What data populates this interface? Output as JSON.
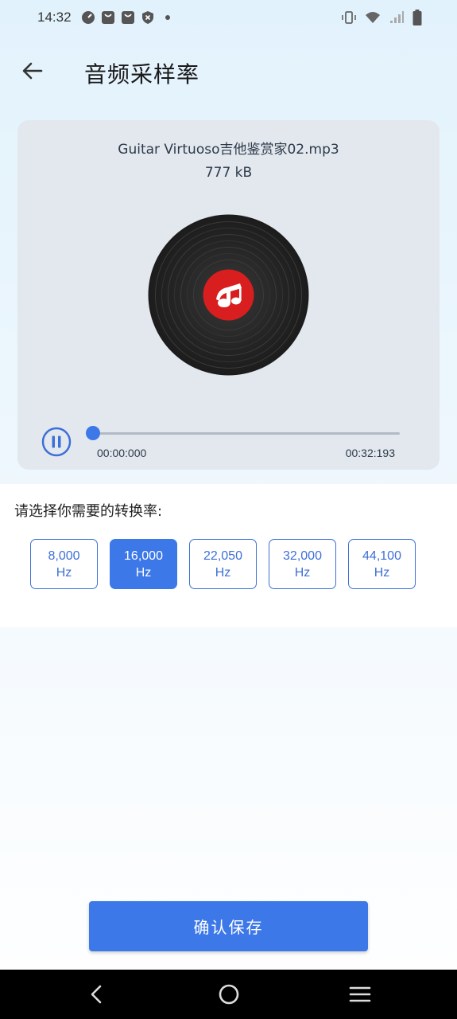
{
  "status_bar": {
    "time": "14:32",
    "left_icons": [
      "speedometer-icon",
      "shopping-bag-icon",
      "shopping-bag-icon",
      "shield-x-icon",
      "dot-icon"
    ],
    "right_icons": [
      "vibrate-icon",
      "wifi-icon",
      "signal-icon",
      "battery-icon"
    ]
  },
  "app_bar": {
    "back_icon": "arrow-left-icon",
    "title": "音频采样率"
  },
  "player": {
    "file_name": "Guitar Virtuoso吉他鉴赏家02.mp3",
    "file_size": "777 kB",
    "state_icon": "pause-icon",
    "current_time": "00:00:000",
    "total_time": "00:32:193",
    "progress": 0.0
  },
  "rate_panel": {
    "prompt": "请选择你需要的转换率:",
    "options": [
      {
        "value": "8,000",
        "unit": "Hz",
        "selected": false
      },
      {
        "value": "16,000",
        "unit": "Hz",
        "selected": true
      },
      {
        "value": "22,050",
        "unit": "Hz",
        "selected": false
      },
      {
        "value": "32,000",
        "unit": "Hz",
        "selected": false
      },
      {
        "value": "44,100",
        "unit": "Hz",
        "selected": false
      }
    ]
  },
  "save_label": "确认保存",
  "colors": {
    "accent": "#3d78e8",
    "card_bg": "#e3e8ee",
    "disc_label": "#d81e1e"
  },
  "nav_bar": {
    "items": [
      "nav-back-icon",
      "nav-home-icon",
      "nav-menu-icon"
    ]
  }
}
